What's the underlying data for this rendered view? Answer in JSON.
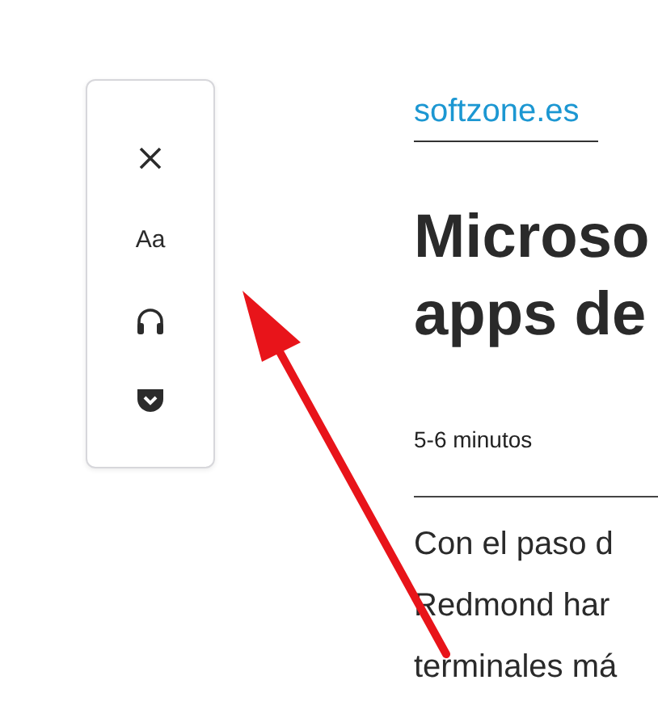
{
  "toolbar": {
    "items": [
      {
        "kind": "close"
      },
      {
        "kind": "type",
        "label": "Aa"
      },
      {
        "kind": "listen"
      },
      {
        "kind": "save"
      }
    ]
  },
  "article": {
    "site": "softzone.es",
    "title_lines": [
      "Microso",
      "apps de"
    ],
    "reading_time": "5-6 minutos",
    "body_lines": [
      "Con el paso d",
      "Redmond har",
      "terminales má"
    ]
  }
}
